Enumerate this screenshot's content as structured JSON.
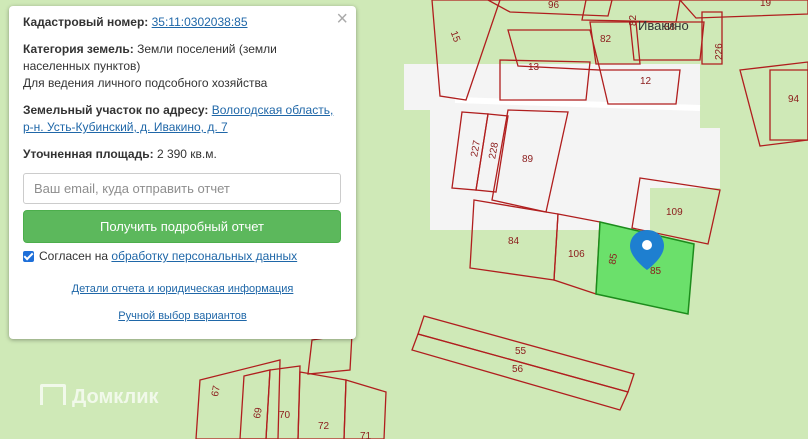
{
  "popup": {
    "cadastral_label": "Кадастровый номер:",
    "cadastral_number": "35:11:0302038:85",
    "category_label": "Категория земель:",
    "category_value_1": "Земли поселений (земли",
    "category_value_2": "населенных пунктов)",
    "category_value_3": "Для ведения личного подсобного хозяйства",
    "address_label": "Земельный участок по адресу:",
    "address_part1": "Вологодская область,",
    "address_part2": "р-н. Усть-Кубинский, д. Ивакино, д. 7",
    "area_label": "Уточненная площадь:",
    "area_value": "2 390 кв.м.",
    "email_placeholder": "Ваш email, куда отправить отчет",
    "email_value": "",
    "submit_label": "Получить подробный отчет",
    "consent_text": "Согласен на",
    "consent_link": "обработку персональных данных",
    "details_link": "Детали отчета и юридическая информация",
    "manual_link": "Ручной выбор вариантов",
    "close_glyph": "×"
  },
  "map": {
    "town_name": "Ивакино",
    "watermark": "Домклик",
    "plots": [
      "96",
      "82",
      "88",
      "15",
      "82",
      "226",
      "13",
      "12",
      "94",
      "227",
      "228",
      "89",
      "109",
      "84",
      "106",
      "85",
      "85",
      "55",
      "56",
      "67",
      "69",
      "70",
      "72",
      "71",
      "19"
    ],
    "selected_plot_color": "#6be06b",
    "boundary_color": "#b01e1e",
    "marker_color": "#1e7fd0"
  }
}
